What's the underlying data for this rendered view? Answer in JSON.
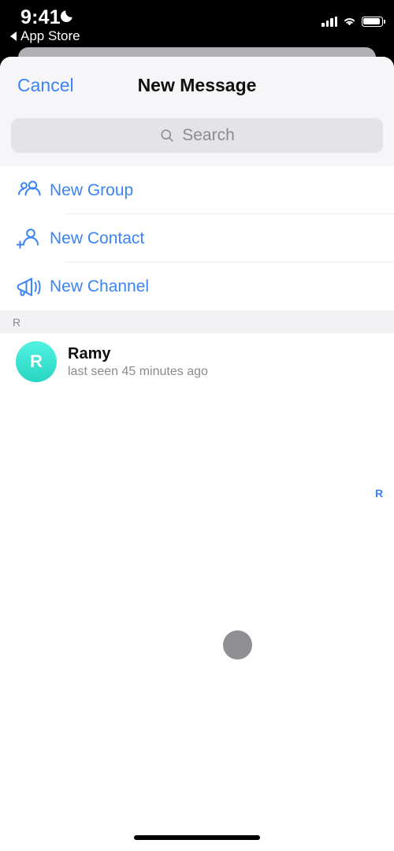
{
  "status_bar": {
    "time": "9:41",
    "dnd_icon": "crescent-moon-icon",
    "back_label": "App Store",
    "back_icon": "triangle-left-icon",
    "signal_icon": "cellular-bars-icon",
    "wifi_icon": "wifi-icon",
    "battery_icon": "battery-icon"
  },
  "nav": {
    "cancel_label": "Cancel",
    "title": "New Message"
  },
  "search": {
    "placeholder": "Search",
    "icon": "magnifier-icon"
  },
  "actions": [
    {
      "label": "New Group",
      "icon": "two-people-icon"
    },
    {
      "label": "New Contact",
      "icon": "person-plus-icon"
    },
    {
      "label": "New Channel",
      "icon": "megaphone-icon"
    }
  ],
  "section": {
    "letter": "R"
  },
  "contacts": [
    {
      "name": "Ramy",
      "status": "last seen 45 minutes ago",
      "initial": "R",
      "avatar_color_top": "#52f2e2",
      "avatar_color_bottom": "#27d6c2"
    }
  ],
  "index_scrubber": {
    "letters": [
      "R"
    ],
    "color": "#3b83f7"
  },
  "touch_indicator": {
    "color": "#8e8e93"
  },
  "theme": {
    "accent_blue": "#3b83f7",
    "sheet_bg": "#ffffff",
    "nav_bg": "#f6f6f8",
    "search_bg": "#e4e4e6",
    "section_bg": "#f2f2f4"
  }
}
